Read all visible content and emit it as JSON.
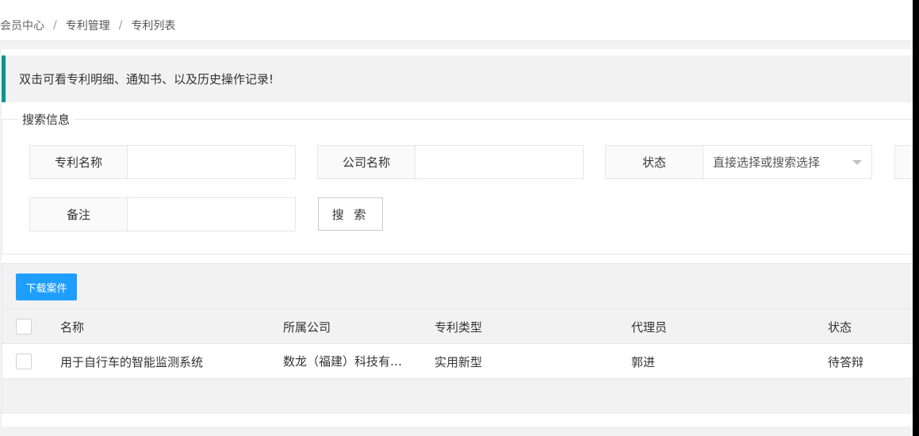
{
  "breadcrumb": {
    "items": [
      "会员中心",
      "专利管理",
      "专利列表"
    ],
    "separator": "/"
  },
  "notice": {
    "text": "双击可看专利明细、通知书、以及历史操作记录!"
  },
  "search": {
    "legend": "搜索信息",
    "patent_name_label": "专利名称",
    "patent_name_value": "",
    "company_name_label": "公司名称",
    "company_name_value": "",
    "status_label": "状态",
    "status_placeholder": "直接选择或搜索选择",
    "remark_label": "备注",
    "remark_value": "",
    "search_button": "搜 索"
  },
  "table": {
    "toolbar": {
      "download_button": "下载案件"
    },
    "columns": [
      "名称",
      "所属公司",
      "专利类型",
      "代理员",
      "状态"
    ],
    "rows": [
      {
        "name": "用于自行车的智能监测系统",
        "company": "数龙（福建）科技有限公司",
        "type": "实用新型",
        "agent": "郭进",
        "status": "待答辩"
      }
    ]
  },
  "colors": {
    "accent_teal": "#009688",
    "primary_blue": "#1e9fff"
  }
}
